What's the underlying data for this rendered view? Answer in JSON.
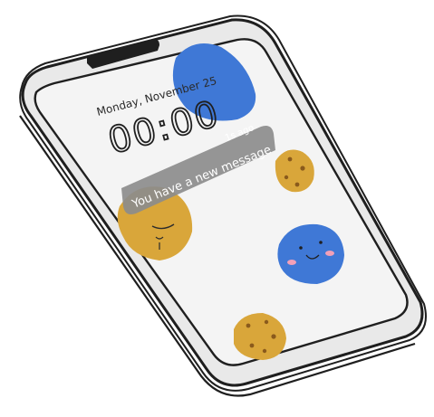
{
  "lock_screen": {
    "date": "Monday, November 25",
    "time": "00:00"
  },
  "notification": {
    "time_ago": "1s ago",
    "message": "You have a new message"
  },
  "colors": {
    "phone_outline": "#1f1f1f",
    "screen_bg": "#f4f4f4",
    "blue_blob": "#3f78d6",
    "cookie": "#d9a63a",
    "cookie_dot": "#8a5a1c",
    "notification_bg": "#8c8c8c",
    "notification_text": "#ffffff",
    "blush": "#f2a0b8"
  },
  "icons": [
    "blue-blob-shape",
    "cookie-shape",
    "smiling-cookie",
    "smiling-blue-blob"
  ]
}
